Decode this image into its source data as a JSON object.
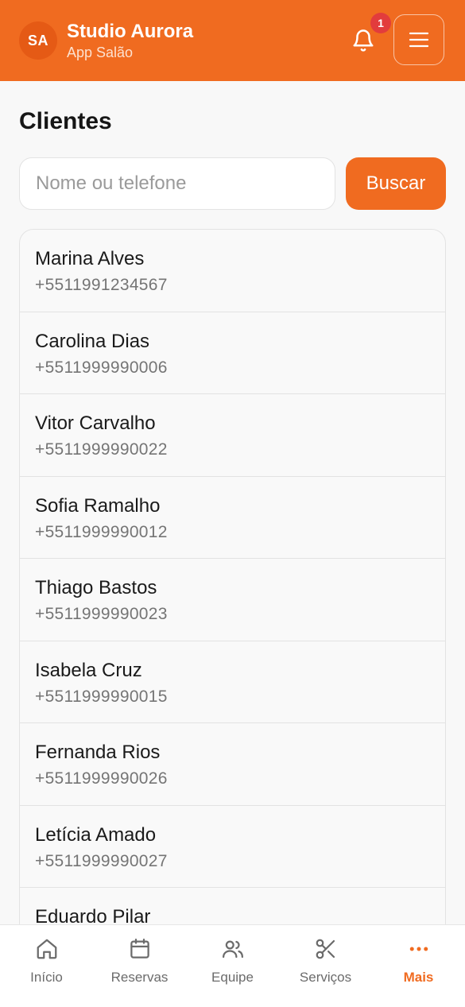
{
  "header": {
    "avatar_initials": "SA",
    "title": "Studio Aurora",
    "subtitle": "App Salão",
    "notification_count": "1",
    "accent_color": "#f06b20"
  },
  "page": {
    "title": "Clientes"
  },
  "search": {
    "placeholder": "Nome ou telefone",
    "value": "",
    "button_label": "Buscar"
  },
  "clients": [
    {
      "name": "Marina Alves",
      "phone": "+5511991234567"
    },
    {
      "name": "Carolina Dias",
      "phone": "+5511999990006"
    },
    {
      "name": "Vitor Carvalho",
      "phone": "+5511999990022"
    },
    {
      "name": "Sofia Ramalho",
      "phone": "+5511999990012"
    },
    {
      "name": "Thiago Bastos",
      "phone": "+5511999990023"
    },
    {
      "name": "Isabela Cruz",
      "phone": "+5511999990015"
    },
    {
      "name": "Fernanda Rios",
      "phone": "+5511999990026"
    },
    {
      "name": "Letícia Amado",
      "phone": "+5511999990027"
    },
    {
      "name": "Eduardo Pilar",
      "phone": ""
    }
  ],
  "nav": {
    "items": [
      {
        "label": "Início",
        "icon": "home-icon"
      },
      {
        "label": "Reservas",
        "icon": "calendar-icon"
      },
      {
        "label": "Equipe",
        "icon": "users-icon"
      },
      {
        "label": "Serviços",
        "icon": "scissors-icon"
      },
      {
        "label": "Mais",
        "icon": "more-icon",
        "active": true
      }
    ]
  }
}
